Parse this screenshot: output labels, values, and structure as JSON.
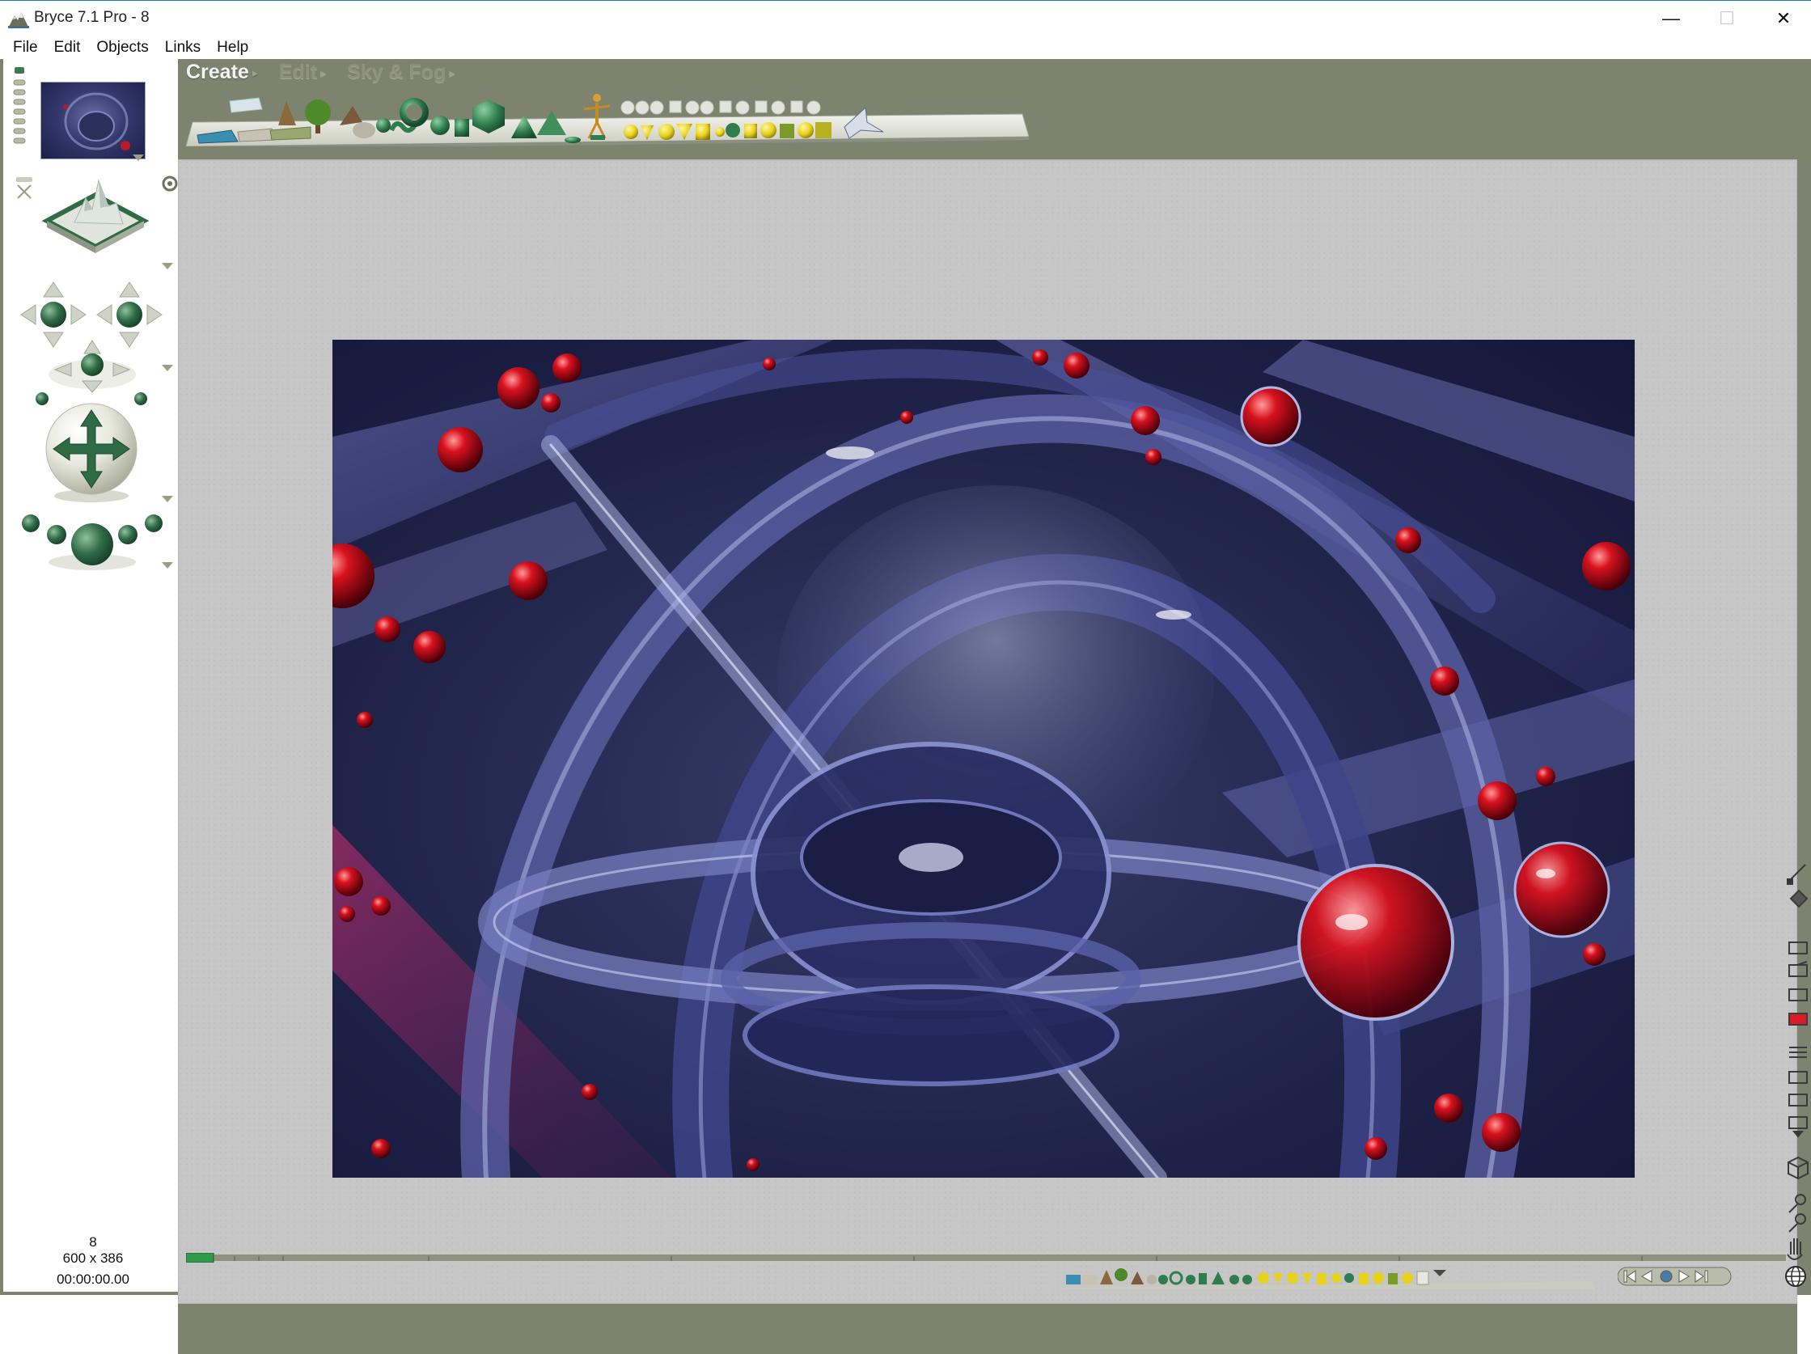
{
  "window": {
    "title": "Bryce 7.1  Pro - 8",
    "min_glyph": "—",
    "max_glyph": "☐",
    "close_glyph": "✕"
  },
  "menu": [
    "File",
    "Edit",
    "Objects",
    "Links",
    "Help"
  ],
  "palette_tabs": [
    {
      "label": "Create",
      "active": true
    },
    {
      "label": "Edit",
      "active": false
    },
    {
      "label": "Sky & Fog",
      "active": false
    }
  ],
  "document": {
    "name": "8",
    "size": "600 x 386",
    "time": "00:00:00.00"
  },
  "colors": {
    "workspace": "#7d836f",
    "canvas": "#c6c6c6",
    "accent_green": "#2f6b45",
    "primitive_yellow": "#e8d21c"
  },
  "icons": {
    "nano_preview": "nano-preview-icon",
    "view_control": "view-control-icon",
    "camera_trackball": "camera-trackball-icon",
    "globe": "globe-icon"
  }
}
